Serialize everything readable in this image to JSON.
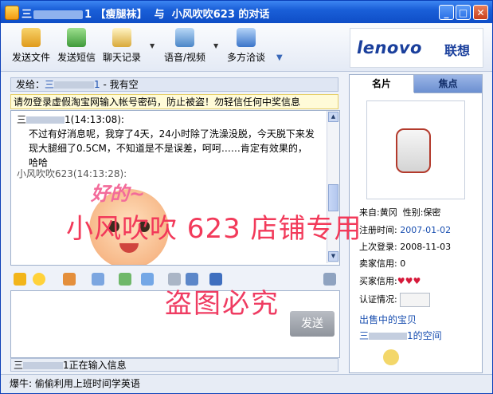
{
  "title": {
    "prefix": "三",
    "num": "1",
    "shop": "【瘦腿袜】",
    "with": "与",
    "contact": "小风吹吹623",
    "suffix": "的对话"
  },
  "toolbar": {
    "send_file": "发送文件",
    "send_sms": "发送短信",
    "chat_log": "聊天记录",
    "voice_video": "语音/视频",
    "multi_chat": "多方洽谈"
  },
  "brand": {
    "logo": "lenovo",
    "cn": "联想"
  },
  "sendto": {
    "label": "发给：",
    "prefix": "三",
    "num": "1",
    "status": "- 我有空"
  },
  "warning": "请勿登录虚假淘宝网输入帐号密码，防止被盗！勿轻信任何中奖信息",
  "history": {
    "m1_sender": "三",
    "m1_num": "1",
    "m1_time": "(14:13:08):",
    "m1_text": "不过有好消息呢，我穿了4天，24小时除了洗澡没脱，今天脱下来发现大腿细了0.5CM，不知道是不是误差，呵呵……肯定有效果的，哈哈",
    "m2_sender": "小风吹吹623",
    "m2_time": "(14:13:28):",
    "sticker_text": "好的~"
  },
  "watermark": {
    "line1": "小风吹吹 623 店铺专用",
    "line2": "盗图必究"
  },
  "input": {
    "send_label": "发送"
  },
  "typing": {
    "prefix": "三",
    "num": "1",
    "text": "正在输入信息"
  },
  "statusbar": "爆牛: 偷偷利用上班时间学英语",
  "profile": {
    "tab_card": "名片",
    "tab_focus": "焦点",
    "from_label": "来自:",
    "from": "黄冈",
    "gender_label": "性别:",
    "gender": "保密",
    "reg_label": "注册时间:",
    "reg": "2007-01-02",
    "last_label": "上次登录:",
    "last": "2008-11-03",
    "seller_label": "卖家信用:",
    "seller": "0",
    "buyer_label": "买家信用:",
    "buyer": "♥♥♥",
    "verify_label": "认证情况:",
    "on_sale": "出售中的宝贝",
    "space_prefix": "三",
    "space_suffix": "1的空间"
  }
}
